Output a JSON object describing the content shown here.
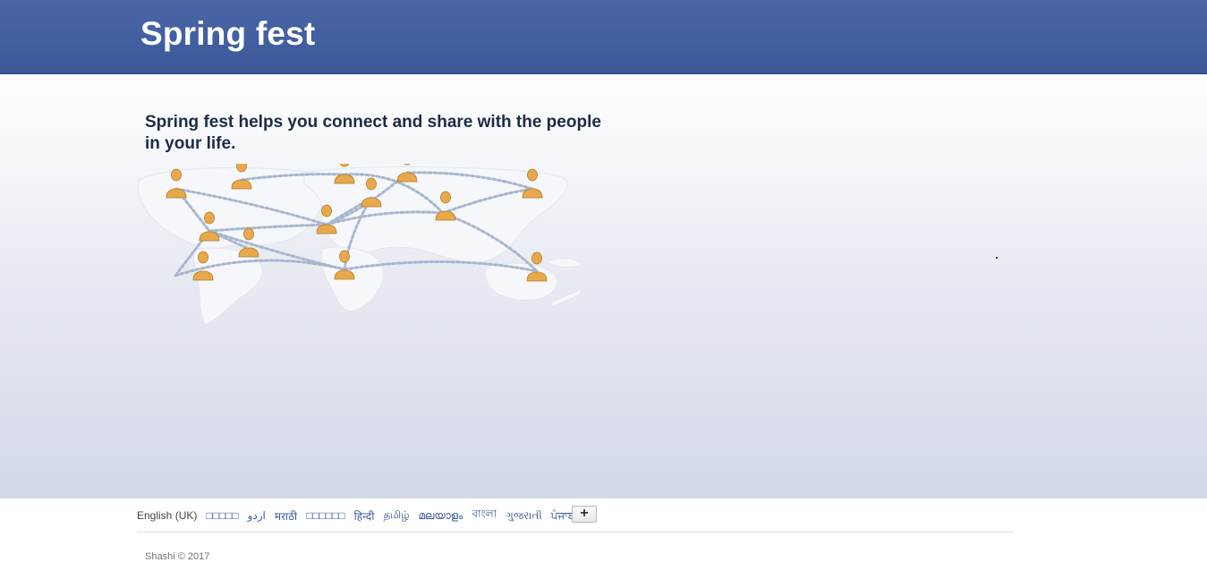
{
  "header": {
    "brand": "Spring fest",
    "brand_color": "#3b5998"
  },
  "main": {
    "tagline": "Spring fest helps you connect and share with the people in your life.",
    "illustration": {
      "map_icon": "world-map",
      "person_icon": "person-icon",
      "person_color": "#e8a94c"
    }
  },
  "footer": {
    "current_language": "English (UK)",
    "languages": [
      "□□□□□",
      "اردو",
      "मराठी",
      "□□□□□□",
      "हिन्दी",
      "தமிழ்",
      "മലയാളം",
      "বাংলা",
      "ગુજરાતી",
      "ਪੰਜਾਬੀ"
    ],
    "more_languages_label": "+",
    "owner": "Shashi",
    "copyright_text": "© 2017"
  }
}
